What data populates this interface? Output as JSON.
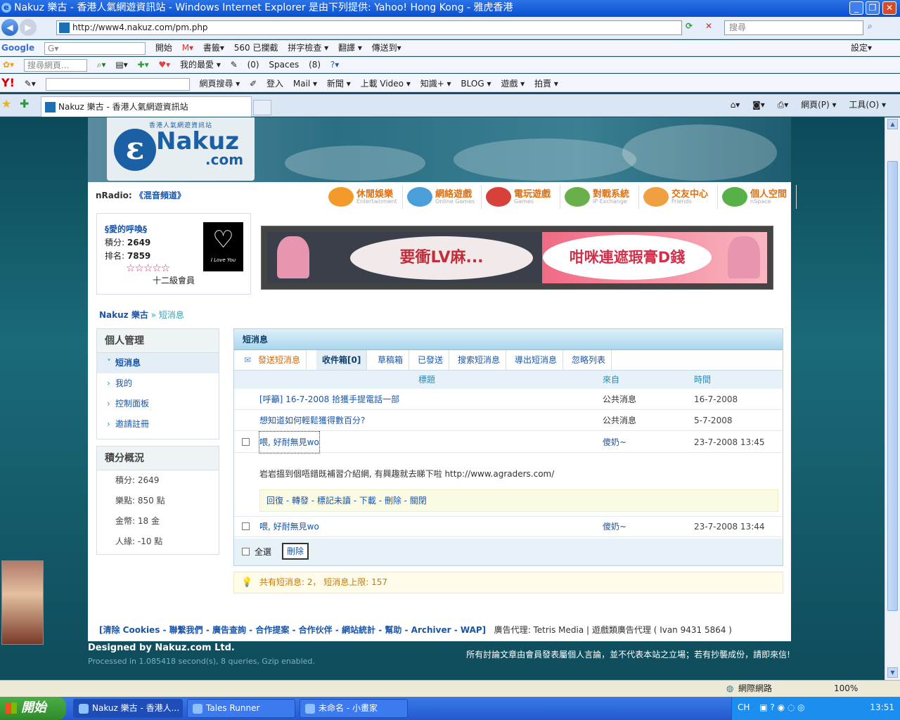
{
  "window": {
    "title": "Nakuz 樂古 - 香港人氣網遊資訊站 - Windows Internet Explorer 是由下列提供: Yahoo! Hong Kong - 雅虎香港",
    "min": "_",
    "max": "❐",
    "close": "✕"
  },
  "address": {
    "url": "http://www4.nakuz.com/pm.php",
    "search_placeholder": "搜尋",
    "back": "◀",
    "fwd": "▶"
  },
  "toolbars": {
    "google": [
      "Google",
      "開始",
      "書籤▾",
      "560 已攔截",
      "拼字檢查 ▾",
      "翻譯 ▾",
      "傳送到▾",
      "設定▾"
    ],
    "yahoo_row1": [
      "搜尋網頁...",
      "我的最愛 ▾",
      "(0)",
      "Spaces",
      "(8)"
    ],
    "yahoo_row2": [
      "Y!",
      "網頁搜尋 ▾",
      "登入",
      "Mail ▾",
      "新聞 ▾",
      "上載 Video ▾",
      "知識+ ▾",
      "BLOG ▾",
      "遊戲 ▾",
      "拍賣 ▾"
    ]
  },
  "tabs": {
    "active": "Nakuz 樂古 - 香港人氣網遊資訊站",
    "cmd": [
      "網頁(P) ▾",
      "工具(O) ▾"
    ]
  },
  "site": {
    "logo_main": "Nakuz",
    "logo_com": ".com",
    "logo_sub": "香港人氣網遊資訊站",
    "nradio_label": "nRadio:",
    "nradio_link": "《混音頻道》",
    "nav": [
      {
        "t": "休閒娛樂",
        "s": "Entertainment",
        "c": "#f39a2a"
      },
      {
        "t": "網絡遊戲",
        "s": "Online Games",
        "c": "#4a9fd8"
      },
      {
        "t": "電玩遊戲",
        "s": "Games",
        "c": "#d8403a"
      },
      {
        "t": "對戰系統",
        "s": "IP Exchange",
        "c": "#6ab04a"
      },
      {
        "t": "交友中心",
        "s": "Friends",
        "c": "#f0a040"
      },
      {
        "t": "個人空間",
        "s": "nSpace",
        "c": "#58b048"
      }
    ]
  },
  "profile": {
    "name": "§愛的呼喚§",
    "score_label": "積分:",
    "score": "2649",
    "rank_label": "排名:",
    "rank": "7859",
    "stars": "☆☆☆☆☆",
    "level": "十二級會員",
    "avatar_caption": "I Love You"
  },
  "ad": {
    "left": "要衝LV麻...",
    "right": "咁咪連遮瑕膏D錢"
  },
  "breadcrumb": {
    "root": "Nakuz 樂古",
    "sep": "»",
    "current": "短消息"
  },
  "sidebar": {
    "title": "個人管理",
    "items": [
      {
        "label": "短消息",
        "active": true
      },
      {
        "label": "我的",
        "active": false
      },
      {
        "label": "控制面板",
        "active": false
      },
      {
        "label": "邀請註冊",
        "active": false
      }
    ],
    "score_title": "積分概況",
    "scores": [
      "積分: 2649",
      "樂點: 850 點",
      "金幣: 18 金",
      "人緣: -10 點"
    ]
  },
  "pm": {
    "title": "短消息",
    "tabs": [
      "發送短消息",
      "收件箱[0]",
      "草稿箱",
      "已發送",
      "搜索短消息",
      "導出短消息",
      "忽略列表"
    ],
    "col_subject": "標題",
    "col_from": "來自",
    "col_time": "時間",
    "rows": [
      {
        "subject": "[呼籲] 16-7-2008 拾獲手提電話一部",
        "from": "公共消息",
        "time": "16-7-2008"
      },
      {
        "subject": "想知道如何輕鬆獲得數百分?",
        "from": "公共消息",
        "time": "5-7-2008"
      },
      {
        "subject": "喂, 好耐無見wo",
        "from": "傻奶~",
        "time": "23-7-2008 13:45"
      },
      {
        "subject": "喂, 好耐無見wo",
        "from": "傻奶~",
        "time": "23-7-2008 13:44"
      }
    ],
    "message_body": "岩岩搵到個唔錯既補習介紹網, 有興趣就去睇下啦   http://www.agraders.com/",
    "message_actions": "回復 - 轉發 - 標記未讀 - 下載 - 刪除 - 關閉",
    "select_all": "全選",
    "delete": "刪除",
    "notice": "共有短消息: 2， 短消息上限: 157"
  },
  "footer": {
    "links": "[清除 Cookies - 聯繫我們 - 廣告查詢 - 合作提案 - 合作伙伴 - 網站統計 - 幫助 - Archiver - WAP]",
    "ad_agent": "廣告代理: Tetris Media | 遊戲類廣告代理 ( Ivan 9431 5864 )",
    "designed": "Designed by Nakuz.com Ltd.",
    "processed": "Processed in 1.085418 second(s), 8 queries, Gzip enabled.",
    "disclaimer": "所有討論文章由會員發表屬個人言論，並不代表本站之立場；若有抄襲成份，請即來信!"
  },
  "status": {
    "zone": "網際網路",
    "zoom": "100%"
  },
  "taskbar": {
    "start": "開始",
    "tasks": [
      "Nakuz 樂古 - 香港人...",
      "Tales Runner",
      "未命名 - 小畫家"
    ],
    "lang": "CH",
    "clock": "13:51"
  }
}
